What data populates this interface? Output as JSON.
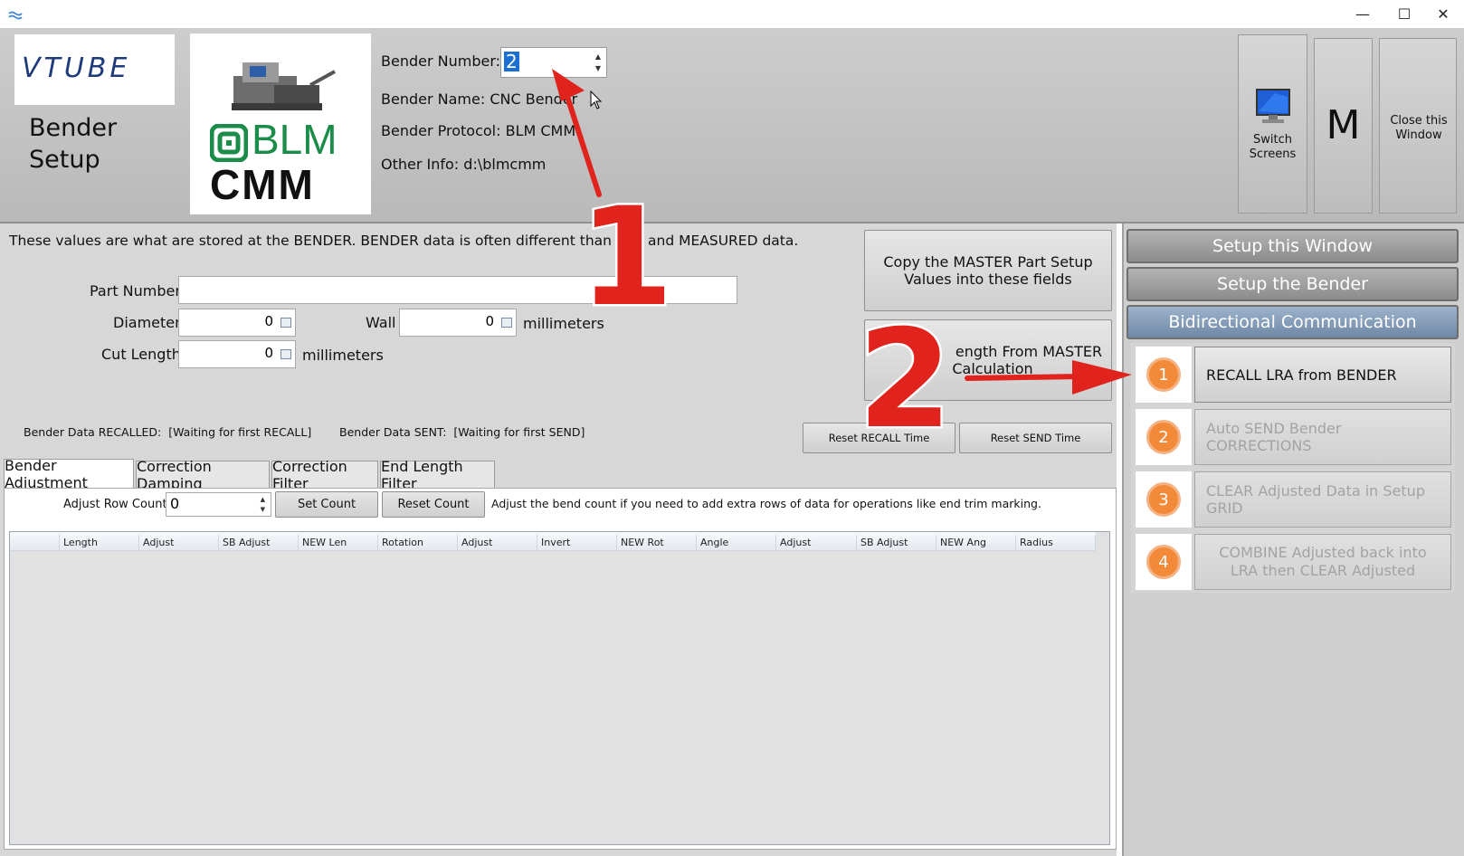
{
  "window": {
    "title": "",
    "min": "—",
    "max": "☐",
    "close": "✕"
  },
  "header": {
    "logo_text": "VTUBE",
    "page_title_line1": "Bender",
    "page_title_line2": "Setup",
    "brand_line1": "BLM",
    "brand_line2": "CMM",
    "bender_number_label": "Bender Number:",
    "bender_number_value": "2",
    "bender_name_label": "Bender Name:",
    "bender_name_value": "CNC Bender",
    "bender_protocol_label": "Bender Protocol:",
    "bender_protocol_value": "BLM CMM",
    "other_info_label": "Other Info:",
    "other_info_value": "d:\\blmcmm",
    "switch_screens": "Switch Screens",
    "m_label": "M",
    "close_window": "Close this Window"
  },
  "main": {
    "info_text": "These values are what are stored at the BENDER.  BENDER data is often different than the",
    "info_text_tail": "and MEASURED data.",
    "copy_master_btn": "Copy the MASTER Part Setup Values into these fields",
    "length_master_btn_line1": "ength From MASTER",
    "length_master_btn_line2": "Calculation",
    "part_number_label": "Part Number",
    "part_number_value": "",
    "diameter_label": "Diameter",
    "diameter_value": "0",
    "wall_label": "Wall",
    "wall_value": "0",
    "wall_units": "millimeters",
    "cut_length_label": "Cut Length",
    "cut_length_value": "0",
    "cut_length_units": "millimeters",
    "recalled_status": "Bender Data RECALLED:  [Waiting for first RECALL]",
    "sent_status": "Bender Data SENT:  [Waiting for first SEND]",
    "reset_recall_btn": "Reset RECALL Time",
    "reset_send_btn": "Reset SEND Time",
    "tabs": [
      "Bender Adjustment",
      "Correction Damping",
      "Correction Filter",
      "End Length Filter"
    ],
    "adjust_row_label": "Adjust Row Count:",
    "adjust_row_value": "0",
    "set_count_btn": "Set Count",
    "reset_count_btn": "Reset Count",
    "adjust_hint": "Adjust the bend count if you need to add extra rows of data for operations like end trim marking.",
    "columns": [
      "",
      "Length",
      "Adjust",
      "SB Adjust",
      "NEW Len",
      "Rotation",
      "Adjust",
      "Invert",
      "NEW Rot",
      "Angle",
      "Adjust",
      "SB Adjust",
      "NEW Ang",
      "Radius"
    ]
  },
  "right_panel": {
    "nav": [
      "Setup this Window",
      "Setup the Bender",
      "Bidirectional Communication"
    ],
    "steps": [
      {
        "num": "1",
        "label": "RECALL LRA from BENDER"
      },
      {
        "num": "2",
        "label": "Auto SEND Bender CORRECTIONS"
      },
      {
        "num": "3",
        "label": "CLEAR Adjusted Data in Setup GRID"
      },
      {
        "num": "4",
        "label": "COMBINE Adjusted back into LRA then CLEAR Adjusted"
      }
    ]
  },
  "annotations": {
    "callout_1": "1",
    "callout_2": "2"
  },
  "colors": {
    "accent_orange": "#f28a3a",
    "arrow_red": "#e0231c",
    "selection_blue": "#1a6fd0"
  }
}
